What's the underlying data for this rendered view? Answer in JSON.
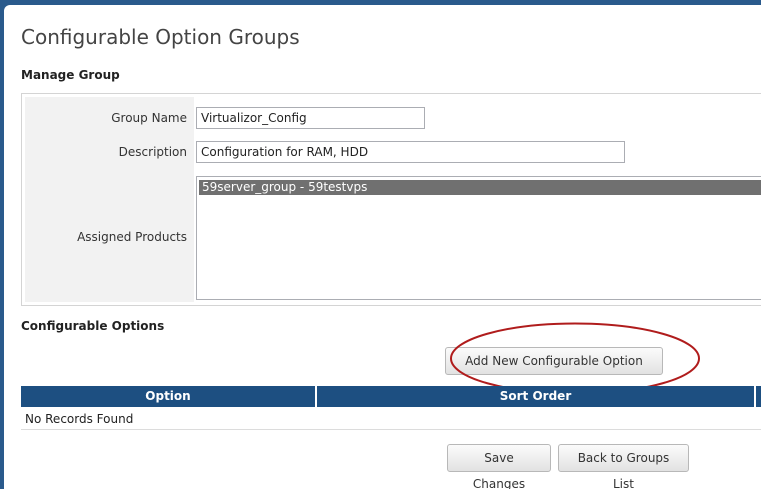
{
  "page": {
    "title": "Configurable Option Groups"
  },
  "manage_group": {
    "heading": "Manage Group",
    "group_name_label": "Group Name",
    "group_name_value": "Virtualizor_Config",
    "description_label": "Description",
    "description_value": "Configuration for RAM, HDD",
    "assigned_products_label": "Assigned Products",
    "assigned_products": [
      "59server_group - 59testvps"
    ]
  },
  "configurable_options": {
    "heading": "Configurable Options",
    "add_button_label": "Add New Configurable Option",
    "columns": [
      "Option",
      "Sort Order"
    ],
    "empty_message": "No Records Found"
  },
  "footer": {
    "save_label": "Save Changes",
    "back_label": "Back to Groups List"
  },
  "colors": {
    "header_bg": "#1d4f81",
    "selected_item_bg": "#707070",
    "highlight_ring": "#b01c1c"
  }
}
